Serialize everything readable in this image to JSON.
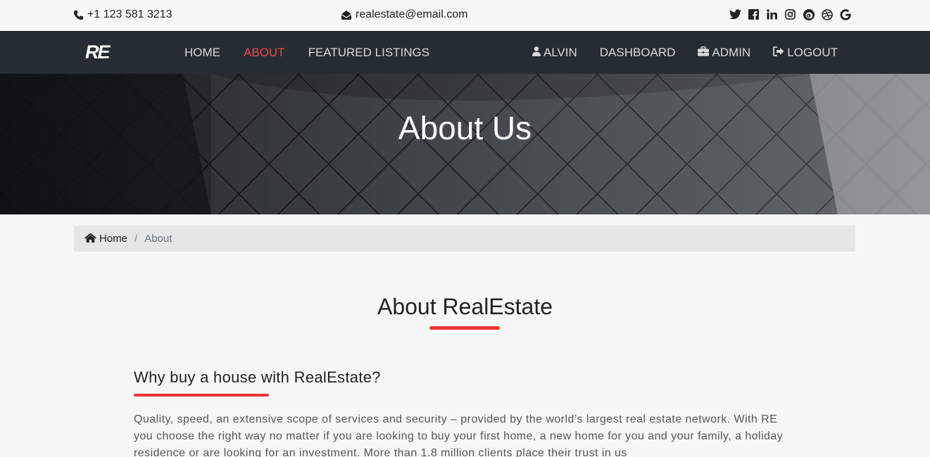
{
  "topbar": {
    "phone": "+1 123 581 3213",
    "email": "realestate@email.com",
    "social": [
      "twitter-icon",
      "facebook-icon",
      "linkedin-icon",
      "instagram-icon",
      "pinterest-icon",
      "dribbble-icon",
      "google-icon"
    ]
  },
  "nav": {
    "logo": "RE",
    "home": "HOME",
    "about": "ABOUT",
    "featured": "FEATURED LISTINGS",
    "user": "ALVIN",
    "dashboard": "DASHBOARD",
    "admin": "ADMIN",
    "logout": "LOGOUT",
    "active_color": "#e74c4c"
  },
  "hero": {
    "title": "About Us"
  },
  "breadcrumb": {
    "home": "Home",
    "separator": "/",
    "current": "About"
  },
  "content": {
    "title": "About RealEstate",
    "subtitle": "Why buy a house with RealEstate?",
    "body": "Quality, speed, an extensive scope of services and security – provided by the world’s largest real estate network. With RE you choose the right way no matter if you are looking to buy your first home, a new home for you and your family, a holiday residence or are looking for an investment. More than 1.8 million clients place their trust in us",
    "accent_color": "#ef3535"
  }
}
